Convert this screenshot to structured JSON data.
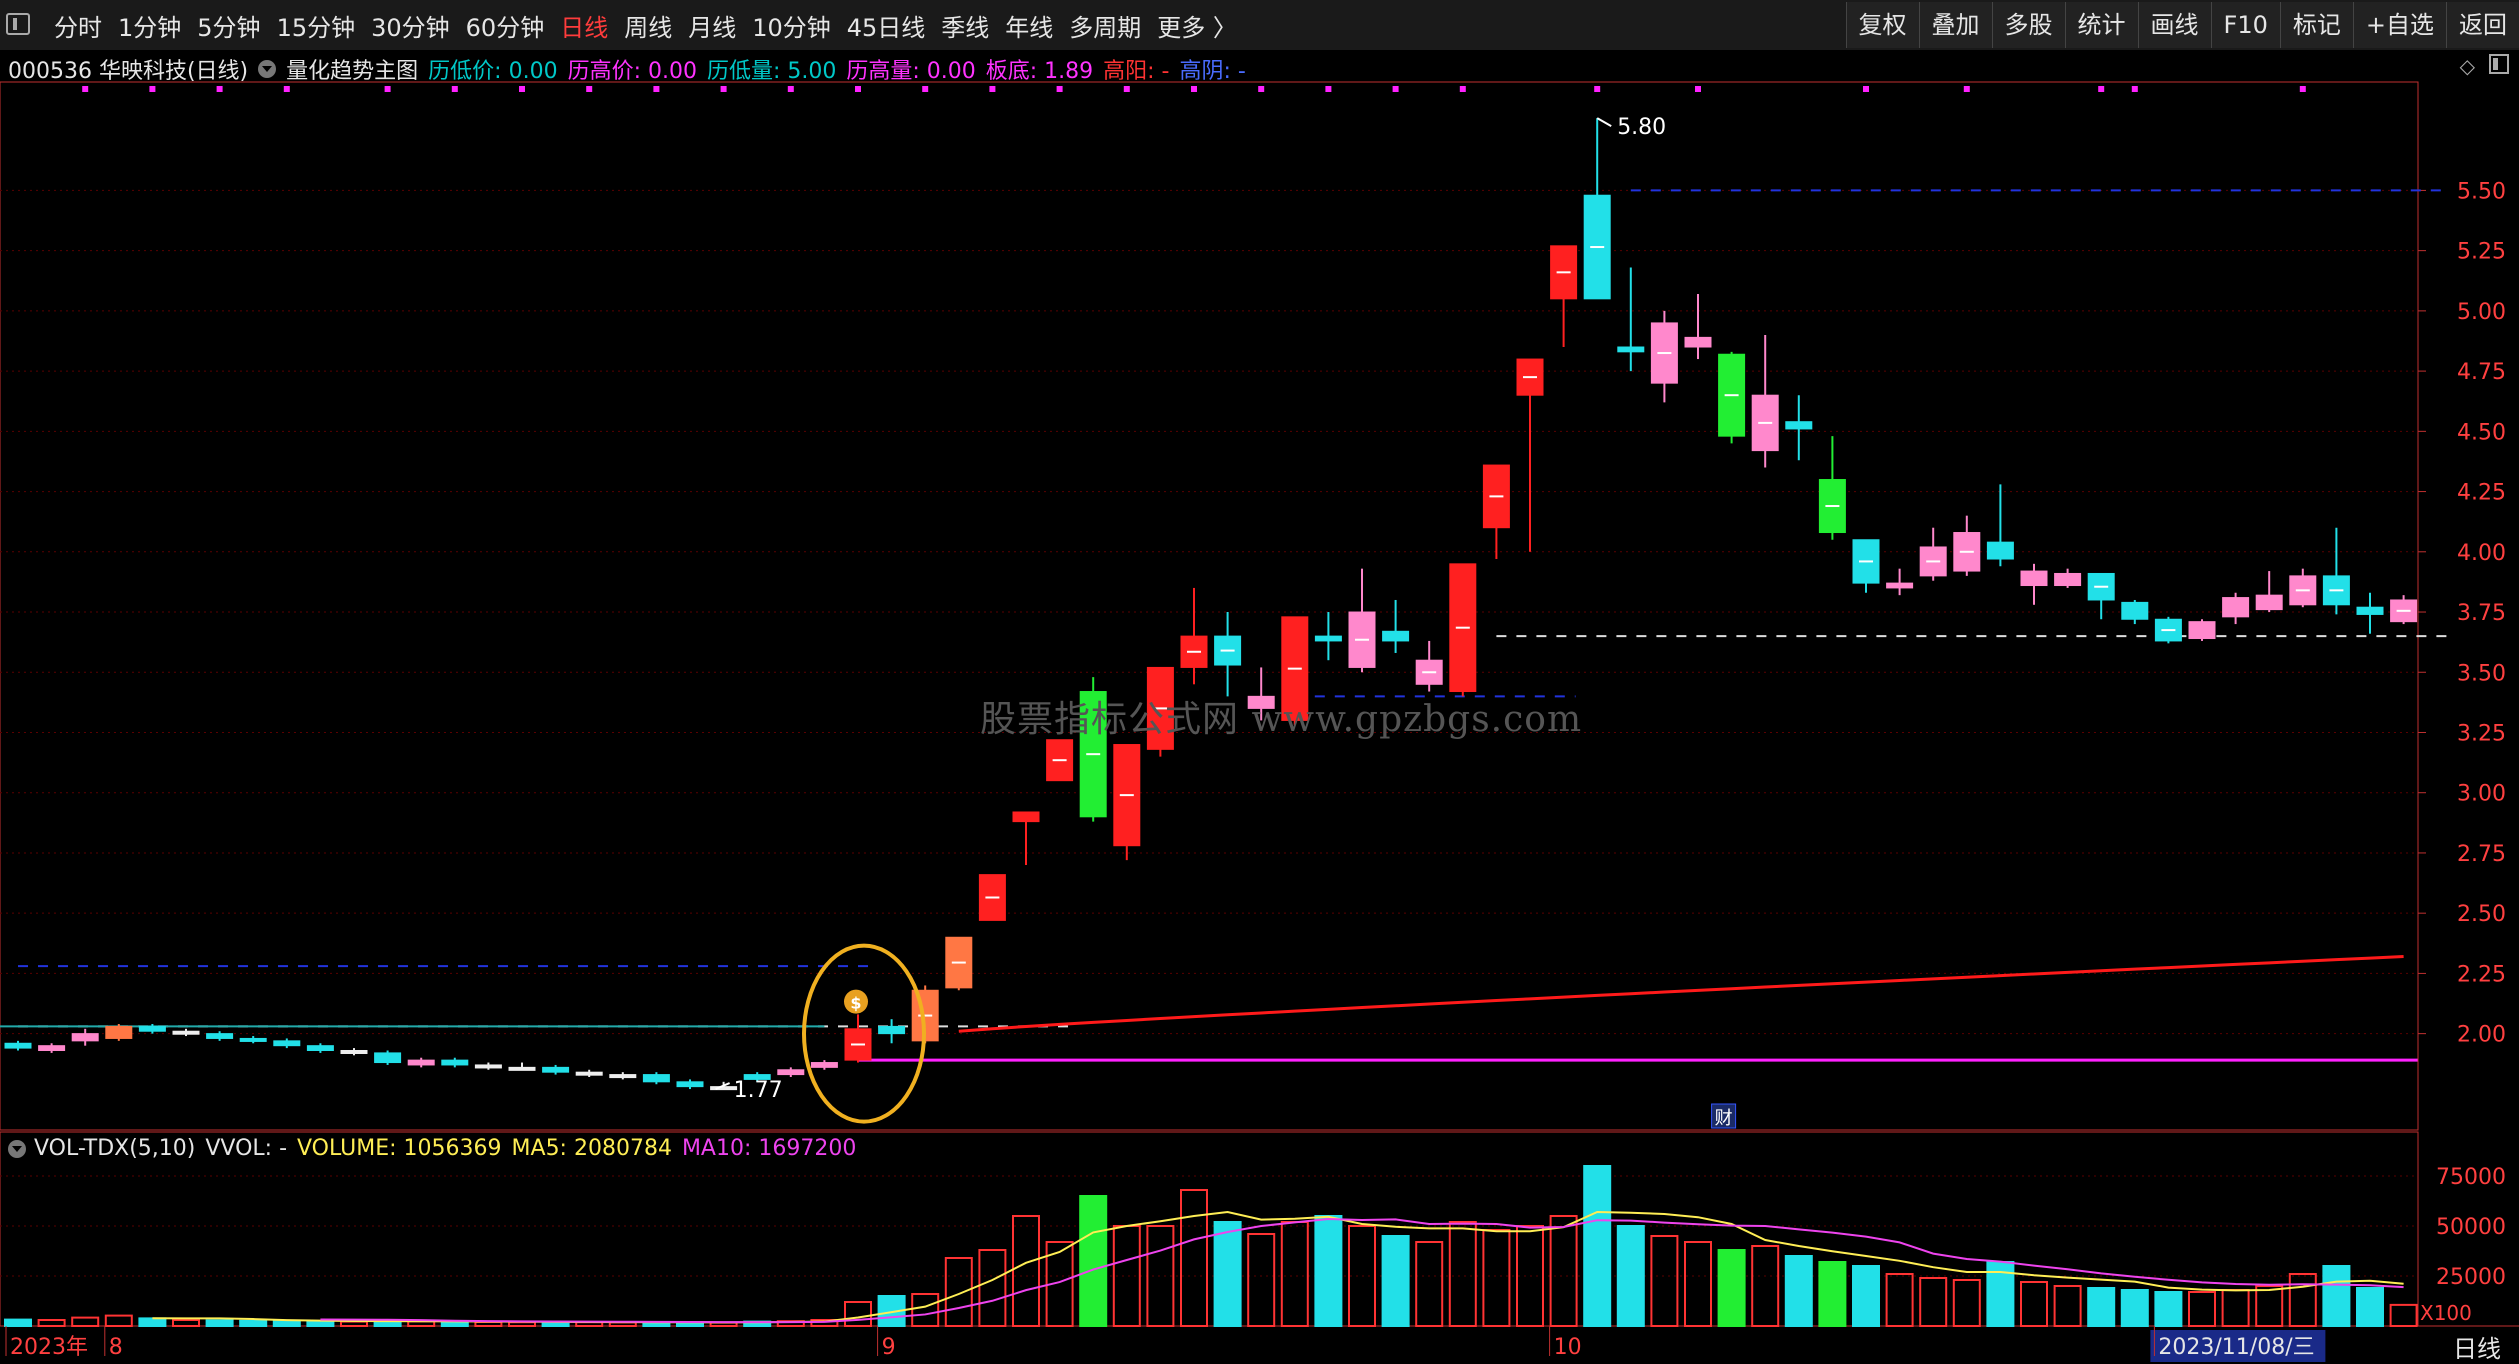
{
  "toolbar": {
    "periods": [
      "分时",
      "1分钟",
      "5分钟",
      "15分钟",
      "30分钟",
      "60分钟",
      "日线",
      "周线",
      "月线",
      "10分钟",
      "45日线",
      "季线",
      "年线",
      "多周期",
      "更多 〉"
    ],
    "active_index": 6,
    "tools": [
      "复权",
      "叠加",
      "多股",
      "统计",
      "画线",
      "F10",
      "标记",
      "+自选",
      "返回"
    ]
  },
  "info": {
    "title": "000536 华映科技(日线)",
    "indicator": "量化趋势主图",
    "items": [
      {
        "text": "历低价: 0.00",
        "color": "#00c8c8"
      },
      {
        "text": "历高价: 0.00",
        "color": "#ff33ff"
      },
      {
        "text": "历低量: 5.00",
        "color": "#00c8c8"
      },
      {
        "text": "历高量: 0.00",
        "color": "#ff33ff"
      },
      {
        "text": "板底: 1.89",
        "color": "#ff33ff"
      },
      {
        "text": "高阳: -",
        "color": "#ff3333"
      },
      {
        "text": "高阴: -",
        "color": "#4a6cff"
      }
    ]
  },
  "volume_header": {
    "name": "VOL-TDX(5,10)",
    "vvol": "VVOL: -",
    "volume": "VOLUME: 1056369",
    "ma5": "MA5: 2080784",
    "ma10": "MA10: 1697200"
  },
  "watermark": "股票指标公式网 www.gpzbgs.com",
  "bottom_period": "日线",
  "chart_data": {
    "type": "candlestick",
    "price_axis": [
      5.5,
      5.25,
      5.0,
      4.75,
      4.5,
      4.25,
      4.0,
      3.75,
      3.5,
      3.25,
      3.0,
      2.75,
      2.5,
      2.25,
      2.0
    ],
    "volume_axis": [
      75000,
      50000,
      25000
    ],
    "volume_unit": "X100",
    "price_range": [
      1.6,
      5.95
    ],
    "volume_range": [
      0,
      82000
    ],
    "high_label": "5.80",
    "low_label": "1.77",
    "finance_marker": "财",
    "date_labels": [
      {
        "text": "2023年",
        "index": 0
      },
      {
        "text": "8",
        "index": 3
      },
      {
        "text": "9",
        "index": 26
      },
      {
        "text": "10",
        "index": 46
      },
      {
        "text": "2023/11/08/三",
        "index": 64
      }
    ],
    "candles": [
      {
        "o": 1.94,
        "c": 1.96,
        "h": 1.97,
        "l": 1.93,
        "v": 3200,
        "col": "cyan"
      },
      {
        "o": 1.93,
        "c": 1.95,
        "h": 1.96,
        "l": 1.92,
        "v": 3000,
        "col": "pink"
      },
      {
        "o": 1.97,
        "c": 2.0,
        "h": 2.02,
        "l": 1.95,
        "v": 4200,
        "col": "pink"
      },
      {
        "o": 1.98,
        "c": 2.03,
        "h": 2.04,
        "l": 1.97,
        "v": 5200,
        "col": "orange"
      },
      {
        "o": 2.03,
        "c": 2.01,
        "h": 2.04,
        "l": 2.0,
        "v": 3800,
        "col": "cyan"
      },
      {
        "o": 2.01,
        "c": 2.0,
        "h": 2.02,
        "l": 1.99,
        "v": 3000,
        "col": "white"
      },
      {
        "o": 2.0,
        "c": 1.98,
        "h": 2.01,
        "l": 1.97,
        "v": 2800,
        "col": "cyan"
      },
      {
        "o": 1.98,
        "c": 1.97,
        "h": 1.99,
        "l": 1.96,
        "v": 2600,
        "col": "cyan"
      },
      {
        "o": 1.97,
        "c": 1.95,
        "h": 1.98,
        "l": 1.94,
        "v": 2500,
        "col": "cyan"
      },
      {
        "o": 1.95,
        "c": 1.93,
        "h": 1.96,
        "l": 1.92,
        "v": 2400,
        "col": "cyan"
      },
      {
        "o": 1.93,
        "c": 1.92,
        "h": 1.94,
        "l": 1.91,
        "v": 2200,
        "col": "white"
      },
      {
        "o": 1.92,
        "c": 1.88,
        "h": 1.93,
        "l": 1.87,
        "v": 2600,
        "col": "cyan"
      },
      {
        "o": 1.87,
        "c": 1.89,
        "h": 1.9,
        "l": 1.86,
        "v": 2300,
        "col": "pink"
      },
      {
        "o": 1.89,
        "c": 1.87,
        "h": 1.9,
        "l": 1.86,
        "v": 2100,
        "col": "cyan"
      },
      {
        "o": 1.87,
        "c": 1.86,
        "h": 1.88,
        "l": 1.85,
        "v": 2000,
        "col": "white"
      },
      {
        "o": 1.86,
        "c": 1.86,
        "h": 1.88,
        "l": 1.85,
        "v": 1900,
        "col": "white"
      },
      {
        "o": 1.86,
        "c": 1.84,
        "h": 1.87,
        "l": 1.83,
        "v": 2000,
        "col": "cyan"
      },
      {
        "o": 1.84,
        "c": 1.83,
        "h": 1.85,
        "l": 1.82,
        "v": 1900,
        "col": "white"
      },
      {
        "o": 1.83,
        "c": 1.82,
        "h": 1.84,
        "l": 1.81,
        "v": 1800,
        "col": "white"
      },
      {
        "o": 1.83,
        "c": 1.8,
        "h": 1.84,
        "l": 1.79,
        "v": 1900,
        "col": "cyan"
      },
      {
        "o": 1.8,
        "c": 1.78,
        "h": 1.81,
        "l": 1.77,
        "v": 1800,
        "col": "cyan"
      },
      {
        "o": 1.78,
        "c": 1.77,
        "h": 1.8,
        "l": 1.77,
        "v": 1700,
        "col": "white"
      },
      {
        "o": 1.81,
        "c": 1.83,
        "h": 1.84,
        "l": 1.8,
        "v": 2200,
        "col": "cyan"
      },
      {
        "o": 1.83,
        "c": 1.85,
        "h": 1.86,
        "l": 1.82,
        "v": 2400,
        "col": "pink"
      },
      {
        "o": 1.86,
        "c": 1.88,
        "h": 1.89,
        "l": 1.85,
        "v": 3000,
        "col": "pink"
      },
      {
        "o": 1.89,
        "c": 2.02,
        "h": 2.08,
        "l": 1.88,
        "v": 12000,
        "col": "red"
      },
      {
        "o": 2.0,
        "c": 2.03,
        "h": 2.06,
        "l": 1.96,
        "v": 15000,
        "col": "cyan"
      },
      {
        "o": 1.97,
        "c": 2.18,
        "h": 2.2,
        "l": 1.96,
        "v": 16000,
        "col": "orange"
      },
      {
        "o": 2.19,
        "c": 2.4,
        "h": 2.4,
        "l": 2.18,
        "v": 34000,
        "col": "orange"
      },
      {
        "o": 2.47,
        "c": 2.66,
        "h": 2.66,
        "l": 2.47,
        "v": 38000,
        "col": "red"
      },
      {
        "o": 2.88,
        "c": 2.92,
        "h": 2.92,
        "l": 2.7,
        "v": 55000,
        "col": "red"
      },
      {
        "o": 3.05,
        "c": 3.22,
        "h": 3.22,
        "l": 3.05,
        "v": 42000,
        "col": "red"
      },
      {
        "o": 3.42,
        "c": 2.9,
        "h": 3.48,
        "l": 2.88,
        "v": 65000,
        "col": "green"
      },
      {
        "o": 2.78,
        "c": 3.2,
        "h": 3.2,
        "l": 2.72,
        "v": 50000,
        "col": "red"
      },
      {
        "o": 3.18,
        "c": 3.52,
        "h": 3.52,
        "l": 3.15,
        "v": 50000,
        "col": "red"
      },
      {
        "o": 3.52,
        "c": 3.65,
        "h": 3.85,
        "l": 3.45,
        "v": 68000,
        "col": "red"
      },
      {
        "o": 3.65,
        "c": 3.53,
        "h": 3.75,
        "l": 3.4,
        "v": 52000,
        "col": "cyan"
      },
      {
        "o": 3.35,
        "c": 3.4,
        "h": 3.52,
        "l": 3.3,
        "v": 46000,
        "col": "pink"
      },
      {
        "o": 3.3,
        "c": 3.73,
        "h": 3.73,
        "l": 3.28,
        "v": 52000,
        "col": "red"
      },
      {
        "o": 3.65,
        "c": 3.63,
        "h": 3.75,
        "l": 3.55,
        "v": 55000,
        "col": "cyan"
      },
      {
        "o": 3.52,
        "c": 3.75,
        "h": 3.93,
        "l": 3.5,
        "v": 50000,
        "col": "pink"
      },
      {
        "o": 3.67,
        "c": 3.63,
        "h": 3.8,
        "l": 3.58,
        "v": 45000,
        "col": "cyan"
      },
      {
        "o": 3.55,
        "c": 3.45,
        "h": 3.63,
        "l": 3.42,
        "v": 42000,
        "col": "pink"
      },
      {
        "o": 3.42,
        "c": 3.95,
        "h": 3.95,
        "l": 3.4,
        "v": 52000,
        "col": "red"
      },
      {
        "o": 4.1,
        "c": 4.36,
        "h": 4.36,
        "l": 3.97,
        "v": 48000,
        "col": "red"
      },
      {
        "o": 4.65,
        "c": 4.8,
        "h": 4.8,
        "l": 4.0,
        "v": 50000,
        "col": "red"
      },
      {
        "o": 5.05,
        "c": 5.27,
        "h": 5.27,
        "l": 4.85,
        "v": 55000,
        "col": "red"
      },
      {
        "o": 5.48,
        "c": 5.05,
        "h": 5.8,
        "l": 5.05,
        "v": 80000,
        "col": "cyan"
      },
      {
        "o": 4.83,
        "c": 4.85,
        "h": 5.18,
        "l": 4.75,
        "v": 50000,
        "col": "cyan"
      },
      {
        "o": 4.7,
        "c": 4.95,
        "h": 5.0,
        "l": 4.62,
        "v": 45000,
        "col": "pink"
      },
      {
        "o": 4.85,
        "c": 4.89,
        "h": 5.07,
        "l": 4.8,
        "v": 42000,
        "col": "pink"
      },
      {
        "o": 4.82,
        "c": 4.48,
        "h": 4.83,
        "l": 4.45,
        "v": 38000,
        "col": "green"
      },
      {
        "o": 4.42,
        "c": 4.65,
        "h": 4.9,
        "l": 4.35,
        "v": 40000,
        "col": "pink"
      },
      {
        "o": 4.54,
        "c": 4.51,
        "h": 4.65,
        "l": 4.38,
        "v": 35000,
        "col": "cyan"
      },
      {
        "o": 4.3,
        "c": 4.08,
        "h": 4.48,
        "l": 4.05,
        "v": 32000,
        "col": "green"
      },
      {
        "o": 4.05,
        "c": 3.87,
        "h": 4.05,
        "l": 3.83,
        "v": 30000,
        "col": "cyan"
      },
      {
        "o": 3.85,
        "c": 3.87,
        "h": 3.93,
        "l": 3.82,
        "v": 26000,
        "col": "pink"
      },
      {
        "o": 3.9,
        "c": 4.02,
        "h": 4.1,
        "l": 3.88,
        "v": 24000,
        "col": "pink"
      },
      {
        "o": 3.92,
        "c": 4.08,
        "h": 4.15,
        "l": 3.9,
        "v": 23000,
        "col": "pink"
      },
      {
        "o": 4.04,
        "c": 3.97,
        "h": 4.28,
        "l": 3.94,
        "v": 32000,
        "col": "cyan"
      },
      {
        "o": 3.86,
        "c": 3.92,
        "h": 3.95,
        "l": 3.78,
        "v": 22000,
        "col": "pink"
      },
      {
        "o": 3.86,
        "c": 3.91,
        "h": 3.93,
        "l": 3.85,
        "v": 20000,
        "col": "pink"
      },
      {
        "o": 3.91,
        "c": 3.8,
        "h": 3.91,
        "l": 3.72,
        "v": 19000,
        "col": "cyan"
      },
      {
        "o": 3.79,
        "c": 3.72,
        "h": 3.8,
        "l": 3.7,
        "v": 18000,
        "col": "cyan"
      },
      {
        "o": 3.72,
        "c": 3.63,
        "h": 3.73,
        "l": 3.62,
        "v": 17000,
        "col": "cyan"
      },
      {
        "o": 3.64,
        "c": 3.71,
        "h": 3.72,
        "l": 3.63,
        "v": 17000,
        "col": "pink"
      },
      {
        "o": 3.73,
        "c": 3.81,
        "h": 3.83,
        "l": 3.7,
        "v": 18000,
        "col": "pink"
      },
      {
        "o": 3.76,
        "c": 3.82,
        "h": 3.92,
        "l": 3.75,
        "v": 20000,
        "col": "pink"
      },
      {
        "o": 3.78,
        "c": 3.9,
        "h": 3.93,
        "l": 3.77,
        "v": 26000,
        "col": "pink"
      },
      {
        "o": 3.9,
        "c": 3.78,
        "h": 4.1,
        "l": 3.74,
        "v": 30000,
        "col": "cyan"
      },
      {
        "o": 3.77,
        "c": 3.74,
        "h": 3.83,
        "l": 3.66,
        "v": 19000,
        "col": "cyan"
      },
      {
        "o": 3.71,
        "c": 3.8,
        "h": 3.82,
        "l": 3.7,
        "v": 10560,
        "col": "pink"
      }
    ],
    "red_line_start_index": 28,
    "red_line_start": 2.01,
    "red_line_end": 2.32,
    "magenta_line_start_index": 25,
    "magenta_line": 1.89,
    "cyan_line": 2.03,
    "dashed_levels": [
      {
        "y": 5.5,
        "from": 48,
        "to": 72,
        "color": "#2233dd"
      },
      {
        "y": 2.28,
        "from": 0,
        "to": 25,
        "color": "#2233dd"
      },
      {
        "y": 3.65,
        "from": 44,
        "to": 72,
        "color": "#dddddd"
      },
      {
        "y": 3.4,
        "from": 38,
        "to": 46,
        "color": "#2233dd"
      },
      {
        "y": 2.03,
        "from": 0,
        "to": 31,
        "color": "#dddddd"
      }
    ],
    "top_dot_indices": [
      2,
      4,
      6,
      8,
      11,
      13,
      15,
      17,
      19,
      21,
      23,
      25,
      27,
      29,
      31,
      33,
      35,
      37,
      39,
      41,
      43,
      47,
      50,
      55,
      58,
      62,
      63,
      68
    ]
  },
  "colors": {
    "red": "#ff2020",
    "cyan": "#22e0e8",
    "green": "#22ee33",
    "pink": "#ff88cc",
    "orange": "#ff7744",
    "white": "#eeeeee",
    "grid": "#5a0000",
    "axis": "#c03030",
    "ma5": "#ffee55",
    "ma10": "#ee44ee",
    "circle": "#f0b020",
    "magenta": "#ff22ff"
  }
}
